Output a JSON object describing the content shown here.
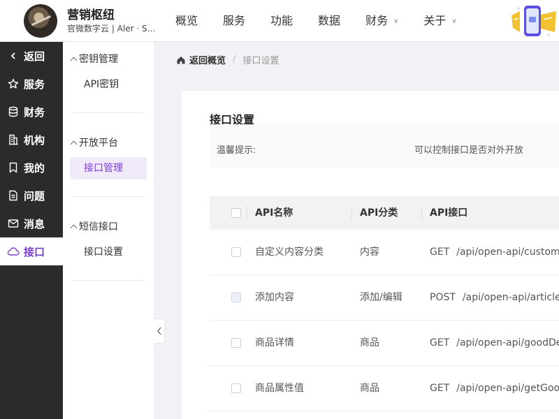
{
  "header": {
    "title": "营销枢纽",
    "subtitle": "官微数字云 | Aler · Se…",
    "nav": [
      {
        "label": "概览",
        "dropdown": false
      },
      {
        "label": "服务",
        "dropdown": false
      },
      {
        "label": "功能",
        "dropdown": false
      },
      {
        "label": "数据",
        "dropdown": false
      },
      {
        "label": "财务",
        "dropdown": true
      },
      {
        "label": "关于",
        "dropdown": true
      }
    ],
    "promo_icon": "phone-promo-icon"
  },
  "sidebar": {
    "items": [
      {
        "label": "返回",
        "icon": "chevron-left-icon",
        "active": false
      },
      {
        "label": "服务",
        "icon": "star-icon",
        "active": false
      },
      {
        "label": "财务",
        "icon": "database-icon",
        "active": false
      },
      {
        "label": "机构",
        "icon": "building-icon",
        "active": false
      },
      {
        "label": "我的",
        "icon": "bookmark-icon",
        "active": false
      },
      {
        "label": "问题",
        "icon": "document-icon",
        "active": false
      },
      {
        "label": "消息",
        "icon": "mail-icon",
        "active": false
      },
      {
        "label": "接口",
        "icon": "cloud-icon",
        "active": true
      }
    ],
    "active_color": "#7b3fd1"
  },
  "submenu": {
    "groups": [
      {
        "title": "密钥管理",
        "items": [
          {
            "label": "API密钥",
            "active": false
          }
        ]
      },
      {
        "title": "开放平台",
        "items": [
          {
            "label": "接口管理",
            "active": true
          }
        ]
      },
      {
        "title": "短信接口",
        "items": [
          {
            "label": "接口设置",
            "active": false
          }
        ]
      }
    ]
  },
  "breadcrumb": {
    "home": "返回概览",
    "separator": "/",
    "current": "接口设置"
  },
  "card": {
    "title": "接口设置",
    "tip_label": "温馨提示:",
    "tip_text": "可以控制接口是否对外开放"
  },
  "table": {
    "headers": [
      "API名称",
      "API分类",
      "API接口"
    ],
    "rows": [
      {
        "name": "自定义内容分类",
        "category": "内容",
        "method": "GET",
        "path": "/api/open-api/customize"
      },
      {
        "name": "添加内容",
        "category": "添加/编辑",
        "method": "POST",
        "path": "/api/open-api/articleAd"
      },
      {
        "name": "商品详情",
        "category": "商品",
        "method": "GET",
        "path": "/api/open-api/goodDeta"
      },
      {
        "name": "商品属性值",
        "category": "商品",
        "method": "GET",
        "path": "/api/open-api/getGoodP"
      }
    ]
  }
}
